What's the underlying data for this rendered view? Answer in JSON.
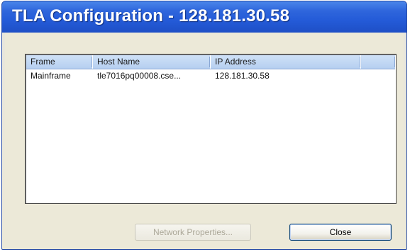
{
  "window": {
    "title": "TLA Configuration - 128.181.30.58"
  },
  "table": {
    "columns": [
      "Frame",
      "Host Name",
      "IP Address",
      ""
    ],
    "rows": [
      {
        "frame": "Mainframe",
        "host_name": "tle7016pq00008.cse...",
        "ip_address": "128.181.30.58"
      }
    ]
  },
  "buttons": {
    "network_properties": "Network Properties...",
    "close": "Close"
  },
  "colors": {
    "titlebar": "#245ad3",
    "header": "#b6cff0",
    "window_bg": "#ece9d8"
  }
}
